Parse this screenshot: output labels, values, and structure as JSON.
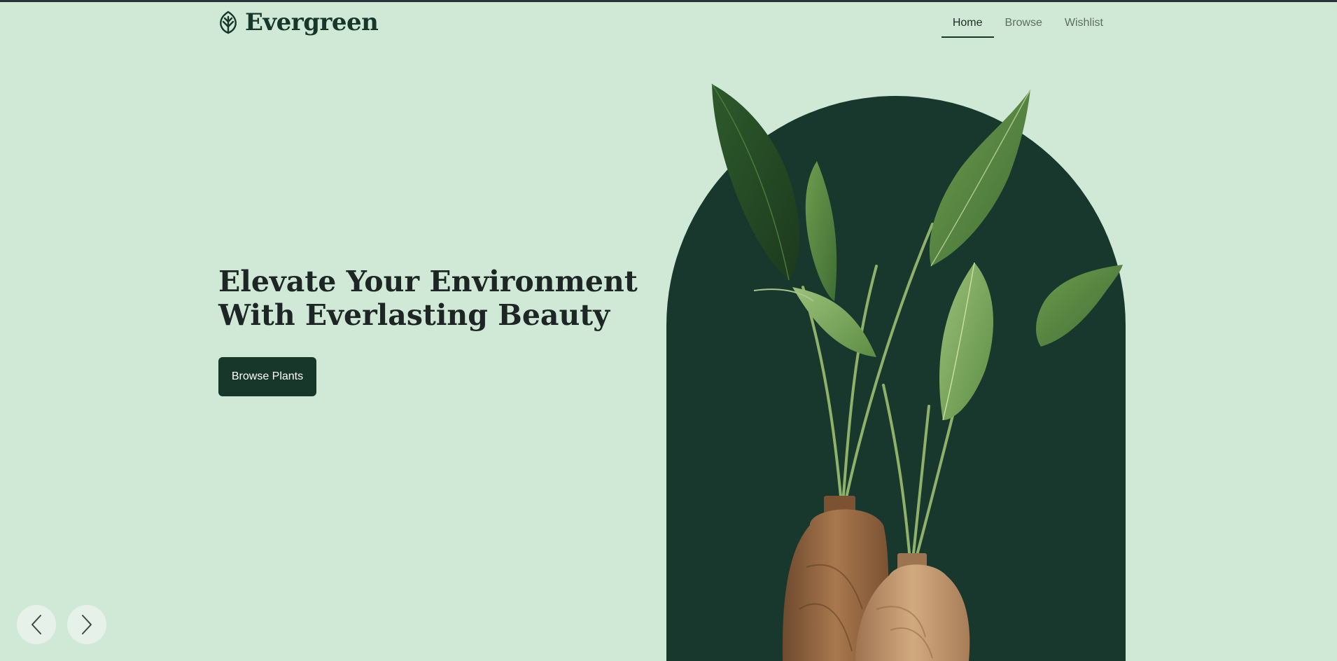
{
  "brand": {
    "name": "Evergreen",
    "logo_icon": "leaf-icon"
  },
  "nav": {
    "items": [
      {
        "label": "Home",
        "active": true
      },
      {
        "label": "Browse",
        "active": false
      },
      {
        "label": "Wishlist",
        "active": false
      }
    ]
  },
  "hero": {
    "headline_line1": "Elevate Your Environment",
    "headline_line2": "With Everlasting Beauty",
    "cta_label": "Browse Plants",
    "image": "potted-plants-in-wooden-vases"
  },
  "carousel": {
    "prev_icon": "chevron-left-icon",
    "next_icon": "chevron-right-icon"
  },
  "colors": {
    "background": "#cfe9d6",
    "primary": "#17372b",
    "arch": "#18372d",
    "text": "#1d2624",
    "nav_muted": "#5f6d66",
    "control_bg": "#e6f2e9"
  }
}
